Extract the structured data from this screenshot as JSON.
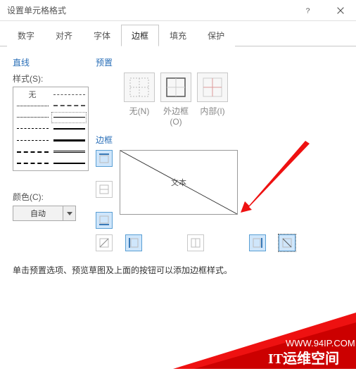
{
  "window": {
    "title": "设置单元格格式"
  },
  "tabs": {
    "number": "数字",
    "align": "对齐",
    "font": "字体",
    "border": "边框",
    "fill": "填充",
    "protect": "保护"
  },
  "line": {
    "section": "直线",
    "style_label": "样式(S):",
    "none_label": "无",
    "color_label": "颜色(C):",
    "color_value": "自动"
  },
  "preset": {
    "section": "预置",
    "none": "无(N)",
    "outer": "外边框(O)",
    "inner": "内部(I)"
  },
  "border": {
    "section": "边框",
    "preview_text": "文本"
  },
  "hint": "单击预置选项、预览草图及上面的按钮可以添加边框样式。",
  "watermark": {
    "url": "WWW.94IP.COM",
    "brand": "IT运维空间"
  }
}
